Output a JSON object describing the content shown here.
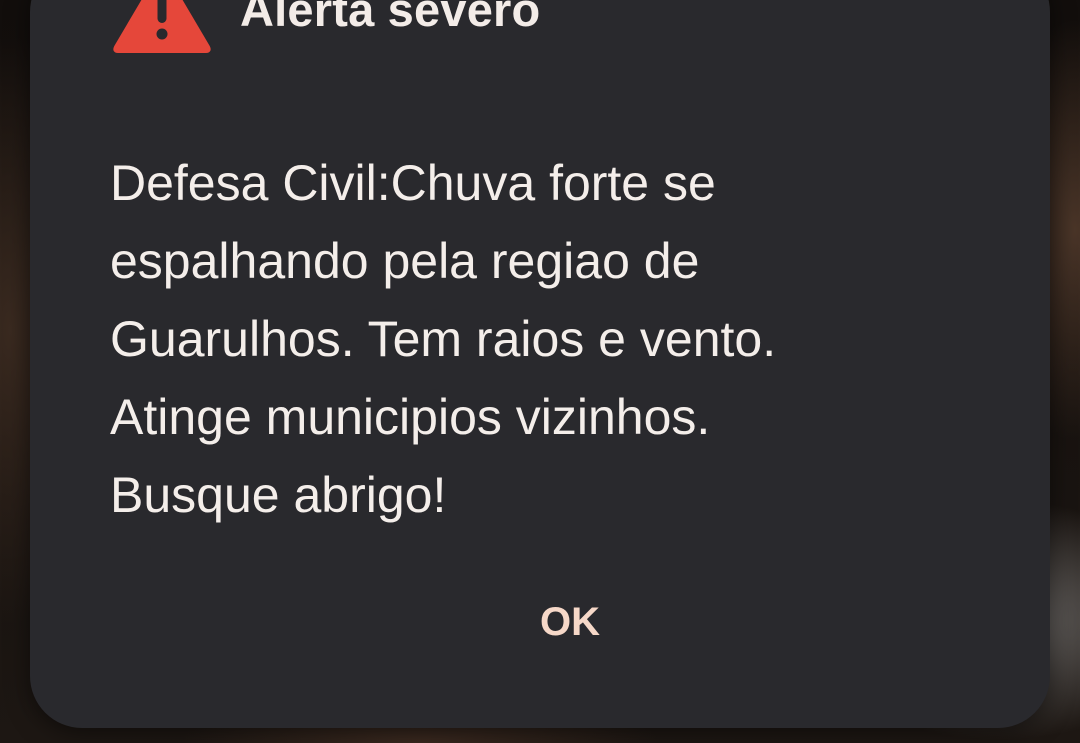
{
  "alert": {
    "title": "Alerta severo",
    "icon": "warning-icon",
    "accent_color": "#e5473a",
    "message": "Defesa Civil:Chuva forte se\nespalhando pela regiao de\nGuarulhos. Tem raios e vento.\nAtinge municipios vizinhos.\nBusque abrigo!",
    "ok_label": "OK"
  }
}
